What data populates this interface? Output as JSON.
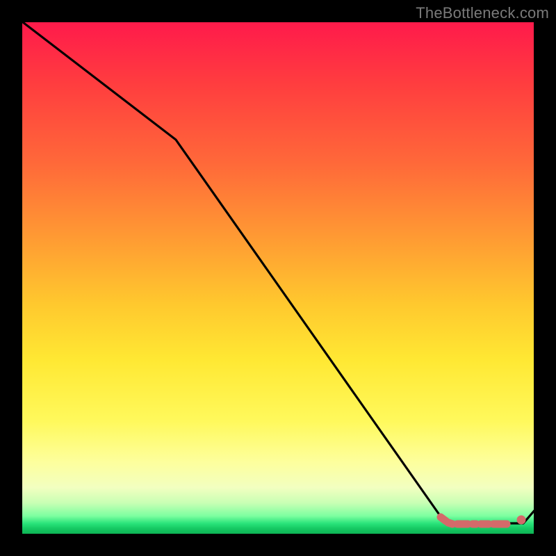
{
  "watermark": "TheBottleneck.com",
  "chart_data": {
    "type": "line",
    "title": "",
    "xlabel": "",
    "ylabel": "",
    "xlim": [
      0,
      100
    ],
    "ylim": [
      0,
      100
    ],
    "grid": false,
    "legend": false,
    "series": [
      {
        "name": "curve",
        "x": [
          0,
          30,
          82,
          84,
          95,
          98,
          100
        ],
        "y": [
          100,
          77,
          3,
          2,
          2,
          2,
          5
        ],
        "color": "#000000"
      }
    ],
    "markers": [
      {
        "shape": "rounded-dash",
        "x_range": [
          82,
          95
        ],
        "y": 2,
        "color": "#d46a6a"
      },
      {
        "shape": "dot",
        "x": 97.5,
        "y": 2.5,
        "color": "#d46a6a"
      }
    ]
  },
  "colors": {
    "marker": "#d46a6a",
    "line": "#000000"
  }
}
